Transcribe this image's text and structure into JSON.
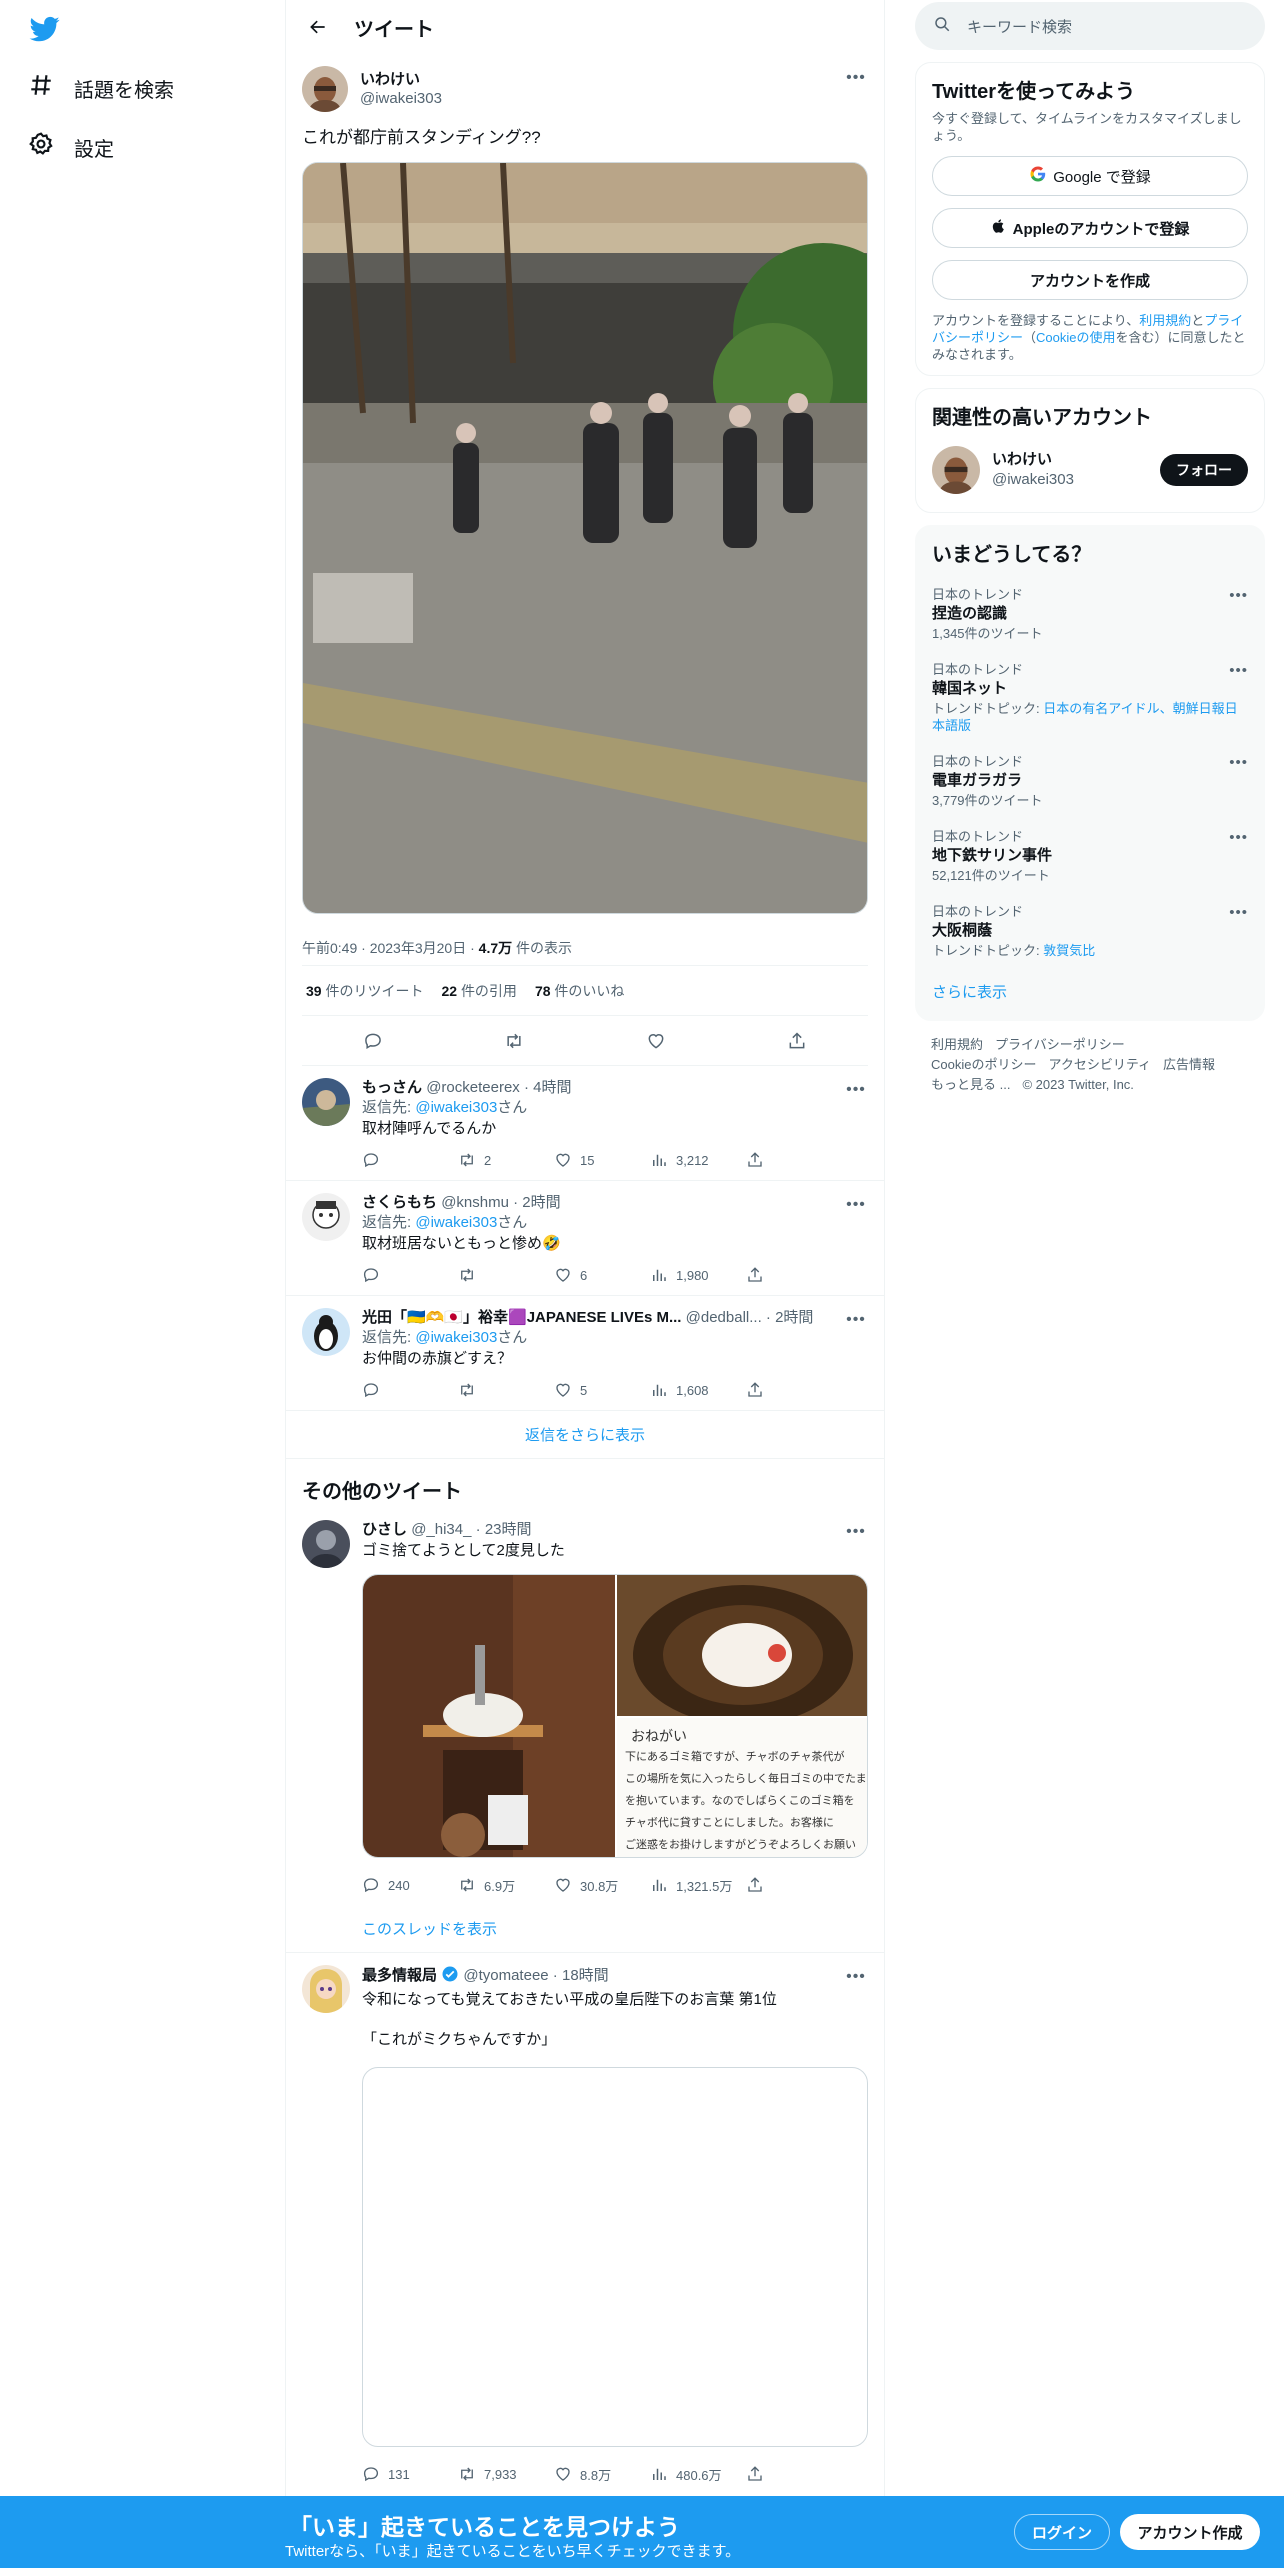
{
  "nav": {
    "items": [
      {
        "label": "話題を検索",
        "icon": "hashtag-icon"
      },
      {
        "label": "設定",
        "icon": "gear-icon"
      }
    ]
  },
  "header": {
    "title": "ツイート"
  },
  "focal": {
    "name": "いわけい",
    "handle": "@iwakei303",
    "text": "これが都庁前スタンディング??",
    "time": "午前0:49",
    "date": "2023年3月20日",
    "views": "4.7万",
    "views_suffix": "件の表示",
    "retweets": "39",
    "retweets_label": "件のリツイート",
    "quotes": "22",
    "quotes_label": "件の引用",
    "likes": "78",
    "likes_label": "件のいいね"
  },
  "replies": [
    {
      "name": "もっさん",
      "handle": "@rocketeerex",
      "time": "4時間",
      "replying_prefix": "返信先: ",
      "replying_to": "@iwakei303",
      "replying_suffix": "さん",
      "text": "取材陣呼んでるんか",
      "reply_count": "",
      "retweet_count": "2",
      "like_count": "15",
      "view_count": "3,212"
    },
    {
      "name": "さくらもち",
      "handle": "@knshmu",
      "time": "2時間",
      "replying_prefix": "返信先: ",
      "replying_to": "@iwakei303",
      "replying_suffix": "さん",
      "text": "取材班居ないともっと惨め🤣",
      "reply_count": "",
      "retweet_count": "",
      "like_count": "6",
      "view_count": "1,980"
    },
    {
      "name": "光田「🇺🇦🫶🇯🇵」裕幸🟪JAPANESE LIVEs M...",
      "handle": "@dedball...",
      "time": "2時間",
      "replying_prefix": "返信先: ",
      "replying_to": "@iwakei303",
      "replying_suffix": "さん",
      "text": "お仲間の赤旗どすえ？",
      "reply_count": "",
      "retweet_count": "",
      "like_count": "5",
      "view_count": "1,608"
    }
  ],
  "show_more_replies": "返信をさらに表示",
  "more_tweets_title": "その他のツイート",
  "other_tweets": [
    {
      "name": "ひさし",
      "handle": "@_hi34_",
      "time": "23時間",
      "text": "ゴミ捨てようとして2度見した",
      "reply_count": "240",
      "retweet_count": "6.9万",
      "like_count": "30.8万",
      "view_count": "1,321.5万",
      "thread_link": "このスレッドを表示",
      "note_heading": "おねがい",
      "note_lines": [
        "下にあるゴミ箱ですが、チャボのチャ茶代が",
        "この場所を気に入ったらしく毎日ゴミの中でたまご",
        "を抱いています。なのでしばらくこのゴミ箱を",
        "チャボ代に貸すことにしました。お客様に",
        "ご迷惑をお掛けしますがどうぞよろしくお願い"
      ]
    },
    {
      "name": "最多情報局",
      "handle": "@tyomateee",
      "time": "18時間",
      "text": "令和になっても覚えておきたい平成の皇后陛下のお言葉 第1位",
      "text2": "「これがミクちゃんですか」",
      "reply_count": "131",
      "retweet_count": "7,933",
      "like_count": "8.8万",
      "view_count": "480.6万"
    }
  ],
  "search": {
    "placeholder": "キーワード検索"
  },
  "signup_card": {
    "title": "Twitterを使ってみよう",
    "subtitle": "今すぐ登録して、タイムラインをカスタマイズしましょう。",
    "google": "Google で登録",
    "apple": "Appleのアカウントで登録",
    "create": "アカウントを作成",
    "terms_1": "アカウントを登録することにより、",
    "terms_link1": "利用規約",
    "terms_2": "と",
    "terms_link2": "プライバシーポリシー",
    "terms_3": "（",
    "terms_link3": "Cookieの使用",
    "terms_4": "を含む）に同意したとみなされます。"
  },
  "relevant": {
    "title": "関連性の高いアカウント",
    "name": "いわけい",
    "handle": "@iwakei303",
    "follow": "フォロー"
  },
  "trends": {
    "title": "いまどうしてる？",
    "items": [
      {
        "category": "日本のトレンド",
        "name": "捏造の認識",
        "sub": "1,345件のツイート",
        "topic_prefix": "",
        "topic": ""
      },
      {
        "category": "日本のトレンド",
        "name": "韓国ネット",
        "sub": "",
        "topic_prefix": "トレンドトピック: ",
        "topic": "日本の有名アイドル、朝鮮日報日本語版"
      },
      {
        "category": "日本のトレンド",
        "name": "電車ガラガラ",
        "sub": "3,779件のツイート",
        "topic_prefix": "",
        "topic": ""
      },
      {
        "category": "日本のトレンド",
        "name": "地下鉄サリン事件",
        "sub": "52,121件のツイート",
        "topic_prefix": "",
        "topic": ""
      },
      {
        "category": "日本のトレンド",
        "name": "大阪桐蔭",
        "sub": "",
        "topic_prefix": "トレンドトピック: ",
        "topic": "敦賀気比"
      }
    ],
    "show_more": "さらに表示"
  },
  "footer": {
    "links": [
      "利用規約",
      "プライバシーポリシー",
      "Cookieのポリシー",
      "アクセシビリティ",
      "広告情報",
      "もっと見る ..."
    ],
    "copyright": "© 2023 Twitter, Inc."
  },
  "bottom": {
    "headline": "「いま」起きていることを見つけよう",
    "sub": "Twitterなら、「いま」起きていることをいち早くチェックできます。",
    "login": "ログイン",
    "signup": "アカウント作成"
  },
  "colors": {
    "accent": "#1d9bf0",
    "text": "#0f1419",
    "muted": "#536471",
    "border": "#eff3f4"
  }
}
